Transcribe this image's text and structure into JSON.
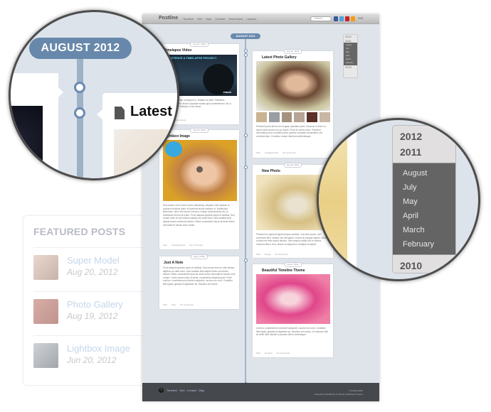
{
  "site": {
    "logo": "Postline",
    "nav": [
      "Timeline",
      "Grid",
      "Map",
      "Contact",
      "Shortcodes",
      "Layouts"
    ],
    "search_placeholder": "Search",
    "social": [
      {
        "name": "facebook",
        "color": "#3b5998"
      },
      {
        "name": "twitter",
        "color": "#4aa3df"
      },
      {
        "name": "pinterest",
        "color": "#cb2027"
      },
      {
        "name": "rss",
        "color": "#f39c12"
      }
    ],
    "rss_label": "RSS",
    "month_label": "AUGUST 2012"
  },
  "posts": [
    {
      "id": "timelapse",
      "date": "Aug 27, 2012",
      "title": "Timelapse Video",
      "text": "Nullam eros, dictum id aliquam in, tristique id vitae. Phasellus malesuada aliquet. Morbi vulputate mauris quis condimentum. Sit ut turpis accumsan tristique ut nec lacus.",
      "meta": [
        "Video",
        "No comments"
      ],
      "image_caption": "EXISTENCE A TIMELAPSE PROJECT",
      "video_brand": "vimeo"
    },
    {
      "id": "gallery",
      "date": "Aug 25, 2012",
      "title": "Latest Photo Gallery",
      "text": "Praesent porta libero nec magna vulputate porta. Vivamus in dolor eu lacus luctus auctor non ac turpis. Proin et rutrum dolor. Praesent venenatis purus convallis ipsum porttitor convallis consectetur orci condimentum. Curabitur ornare interdum pellentesque.",
      "meta": [
        "Nick",
        "Uncategorized",
        "No comments"
      ]
    },
    {
      "id": "lightbox",
      "date": "Aug 24, 2012",
      "title": "Lightbox Image",
      "text": "Duis auctor orci et odio cursus adipiscing. Aliquam erat volutpat. In posuere faucibus justo, et faucibus lectus sodales ut. Vestibulum bibendum, dolor sed auctor rhoncus, massa nulla faucibus dui, in sollicitudin elit est at lorem. Proin aliquam gravida turpis et facilisis. Sed ornare enim et odio dictum dapibus ac vitae dolor. Duis sodales felis aliquet lectus commodo dictum. Etiam consectetur lacus sit amet lectus venenatis et iaculis urna ornare.",
      "meta": [
        "Nick",
        "Uncategorized",
        "No comments"
      ]
    },
    {
      "id": "newphoto",
      "date": "Aug 23, 2012",
      "title": "New Photo",
      "text": "Praesent eu ligula at ligula tempus porttitor, in at sem ipsum, sed commodo felis. Nullam nec elit sapien. Donec at congue sapien. Mauris a diam nec felis auctor ultrices. Sed tempus mattis orci in viverra. Vivamus libero eros, dictum id aliquam in, tristique id sapien.",
      "meta": [
        "Nick",
        "Image",
        "No comments"
      ]
    },
    {
      "id": "note",
      "date": "Aug 3, 2012",
      "title": "Just A Note",
      "text": "Proin aliquam gravida turpis et facilisis. Sed ornare enim et odio dictum dapibus ac vitae dolor. Duis sodales felis aliquet lectus commodo dictum. Etiam consectetur lacus sit amet lectus venenatis et iaculis urna ornare. Lorem ipsum dolor sit amet, consectetur adipiscing elit. Proin erat leo, condimentum sit amet volutpat in, auctor nec urna. Curabitur felis ligula, gravida et dignissim ac, faucibus vel metus.",
      "meta": [
        "Nick",
        "Note",
        "No comments"
      ]
    },
    {
      "id": "theme",
      "date": "Aug 2, 2012",
      "title": "Beautiful Timeline Theme",
      "text": "erat leo, condimentum sit amet volutpat in, auctor nec urna. Curabitur felis ligula, gravida et dignissim ac, faucibus vel metus. Ut euismod nibh sit amet nibh blandit in posuere libero scelerisque.",
      "meta": [
        "Nick",
        "General",
        "No comments"
      ]
    }
  ],
  "archive": {
    "years_top": [
      "2012",
      "2011"
    ],
    "months": [
      "August",
      "July",
      "May",
      "April",
      "March",
      "February"
    ],
    "years_bottom": [
      "2010"
    ]
  },
  "footer": {
    "nav": [
      "Timeline",
      "Grid",
      "Contact",
      "Map"
    ],
    "copyright": "© Postline 2012",
    "powered": "Powered by WordPress & Themify WordPress Themes"
  },
  "featured": {
    "heading": "FEATURED POSTS",
    "items": [
      {
        "title": "Super Model",
        "date": "Aug 20, 2012"
      },
      {
        "title": "Photo Gallery",
        "date": "Aug 19, 2012"
      },
      {
        "title": "Lightbox Image",
        "date": "Jun 20, 2012"
      }
    ]
  },
  "zoom_callout": {
    "month_label": "AUGUST 2012",
    "post_title": "Latest P"
  }
}
